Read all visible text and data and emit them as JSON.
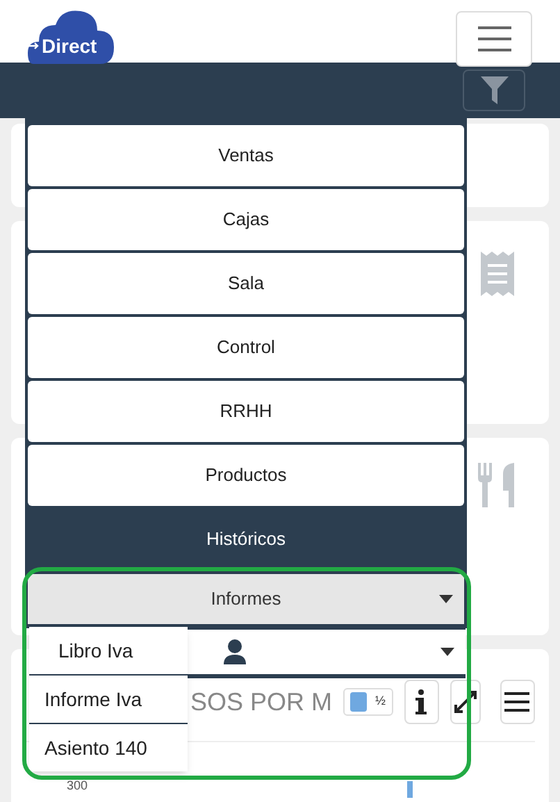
{
  "header": {
    "logo": "Direct"
  },
  "menu": {
    "items": [
      {
        "label": "Ventas",
        "kind": "button"
      },
      {
        "label": "Cajas",
        "kind": "button"
      },
      {
        "label": "Sala",
        "kind": "button"
      },
      {
        "label": "Control",
        "kind": "button"
      },
      {
        "label": "RRHH",
        "kind": "button"
      },
      {
        "label": "Productos",
        "kind": "button"
      },
      {
        "label": "Históricos",
        "kind": "heading"
      }
    ],
    "dropdown": {
      "label": "Informes",
      "expanded": true,
      "items": [
        "Libro Iva",
        "Informe Iva",
        "Asiento 140"
      ]
    }
  },
  "chart_card": {
    "title_fragment": "SOS POR M",
    "legend_label": "½",
    "axis_label": "300"
  }
}
